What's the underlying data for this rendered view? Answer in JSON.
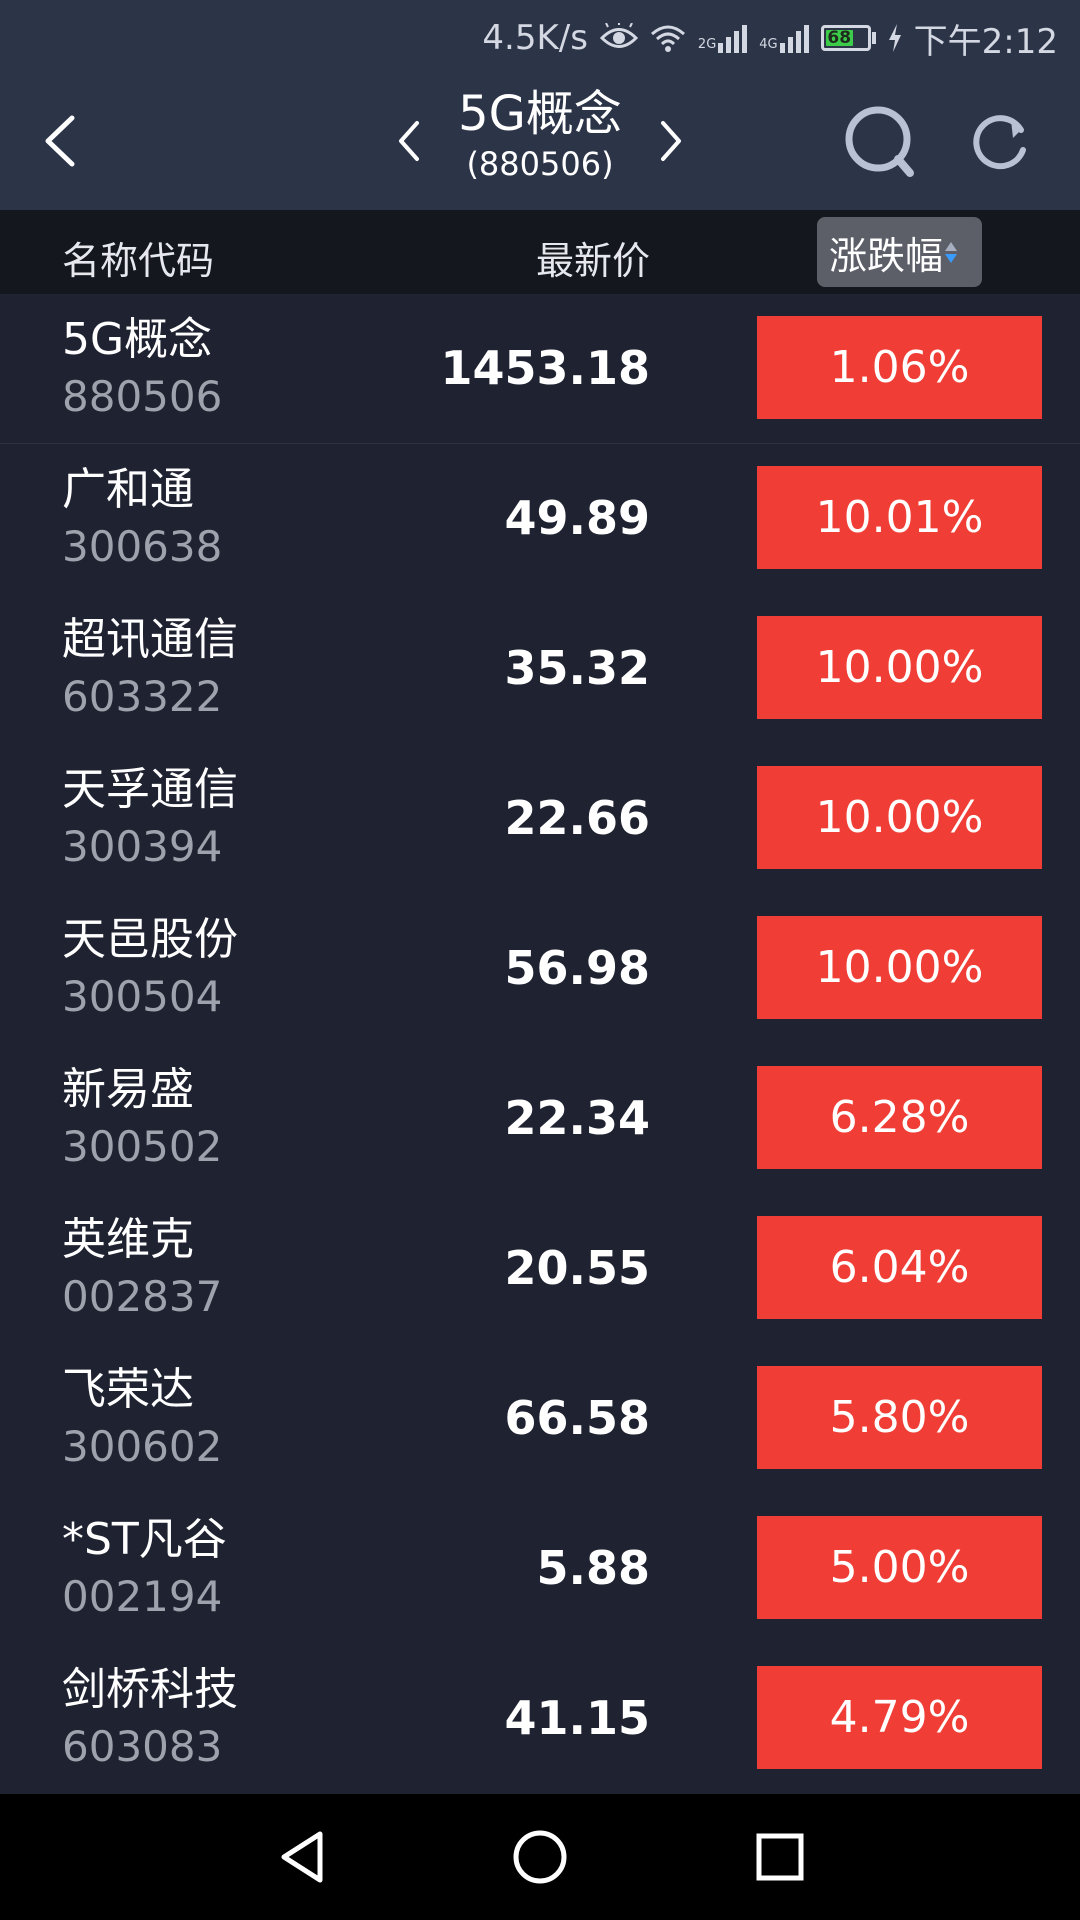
{
  "status_bar": {
    "net_speed": "4.5K/s",
    "net_tag_1": "2G",
    "net_tag_2": "4G",
    "battery": "68",
    "time": "下午2:12",
    "icons": [
      "eye-icon",
      "wifi-icon",
      "signal-icon",
      "signal-icon",
      "battery-icon",
      "charging-icon"
    ]
  },
  "header": {
    "title": "5G概念",
    "code": "(880506)",
    "icons": [
      "back-arrow-icon",
      "prev-chevron-icon",
      "next-chevron-icon",
      "search-icon",
      "refresh-icon"
    ]
  },
  "columns": {
    "name": "名称代码",
    "price": "最新价",
    "change": "涨跌幅"
  },
  "rows": [
    {
      "name": "5G概念",
      "code": "880506",
      "price": "1453.18",
      "change": "1.06%"
    },
    {
      "name": "广和通",
      "code": "300638",
      "price": "49.89",
      "change": "10.01%"
    },
    {
      "name": "超讯通信",
      "code": "603322",
      "price": "35.32",
      "change": "10.00%"
    },
    {
      "name": "天孚通信",
      "code": "300394",
      "price": "22.66",
      "change": "10.00%"
    },
    {
      "name": "天邑股份",
      "code": "300504",
      "price": "56.98",
      "change": "10.00%"
    },
    {
      "name": "新易盛",
      "code": "300502",
      "price": "22.34",
      "change": "6.28%"
    },
    {
      "name": "英维克",
      "code": "002837",
      "price": "20.55",
      "change": "6.04%"
    },
    {
      "name": "飞荣达",
      "code": "300602",
      "price": "66.58",
      "change": "5.80%"
    },
    {
      "name": "*ST凡谷",
      "code": "002194",
      "price": "5.88",
      "change": "5.00%"
    },
    {
      "name": "剑桥科技",
      "code": "603083",
      "price": "41.15",
      "change": "4.79%"
    }
  ],
  "colors": {
    "header_bg": "#2c3448",
    "list_bg": "#1f2230",
    "up_red": "#f03e36",
    "code_gray": "#9da2ad"
  },
  "nav_bar": {
    "icons": [
      "nav-back-icon",
      "nav-home-icon",
      "nav-recent-icon"
    ]
  }
}
